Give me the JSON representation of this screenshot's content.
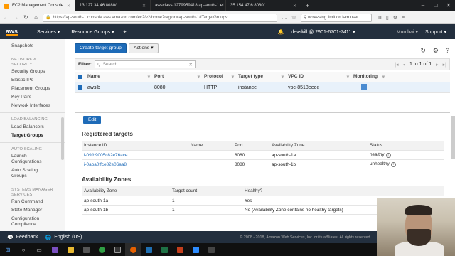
{
  "browser": {
    "tabs": [
      {
        "label": "EC2 Management Console",
        "active": true
      },
      {
        "label": "13.127.34.46:8080/",
        "active": false
      },
      {
        "label": "awsclass-1279959418.ap-south-1.el",
        "active": false
      },
      {
        "label": "35.154.47.6:8080/",
        "active": false
      }
    ],
    "url": "https://ap-south-1.console.aws.amazon.com/ec2/v2/home?region=ap-south-1#TargetGroups:",
    "search_value": "ncreasing limit on iam user"
  },
  "aws_nav": {
    "logo": "aws",
    "services": "Services",
    "resource_groups": "Resource Groups",
    "account": "devskill @ 2901-6701-7411",
    "region": "Mumbai",
    "support": "Support"
  },
  "sidebar": {
    "items": [
      {
        "type": "item",
        "label": "Snapshots"
      },
      {
        "type": "head",
        "label": "NETWORK & SECURITY"
      },
      {
        "type": "item",
        "label": "Security Groups"
      },
      {
        "type": "item",
        "label": "Elastic IPs"
      },
      {
        "type": "item",
        "label": "Placement Groups"
      },
      {
        "type": "item",
        "label": "Key Pairs"
      },
      {
        "type": "item",
        "label": "Network Interfaces"
      },
      {
        "type": "head",
        "label": "LOAD BALANCING"
      },
      {
        "type": "item",
        "label": "Load Balancers"
      },
      {
        "type": "item",
        "label": "Target Groups",
        "active": true
      },
      {
        "type": "head",
        "label": "AUTO SCALING"
      },
      {
        "type": "item",
        "label": "Launch Configurations"
      },
      {
        "type": "item",
        "label": "Auto Scaling Groups"
      },
      {
        "type": "head",
        "label": "SYSTEMS MANAGER SERVICES"
      },
      {
        "type": "item",
        "label": "Run Command"
      },
      {
        "type": "item",
        "label": "State Manager"
      },
      {
        "type": "item",
        "label": "Configuration Compliance"
      }
    ]
  },
  "main": {
    "create_button": "Create target group",
    "actions_button": "Actions",
    "filter_label": "Filter:",
    "search_placeholder": "Search",
    "pager_text": "1 to 1 of 1",
    "columns": [
      "Name",
      "Port",
      "Protocol",
      "Target type",
      "VPC ID",
      "Monitoring"
    ],
    "rows": [
      {
        "name": "awslb",
        "port": "8080",
        "protocol": "HTTP",
        "target_type": "instance",
        "vpc_id": "vpc-8518eeec"
      }
    ]
  },
  "detail": {
    "edit_button": "Edit",
    "registered_title": "Registered targets",
    "registered_columns": [
      "Instance ID",
      "Name",
      "Port",
      "Availability Zone",
      "Status"
    ],
    "registered_rows": [
      {
        "instance_id": "i-09fb9005c82e76ace",
        "name": "",
        "port": "8080",
        "az": "ap-south-1a",
        "status": "healthy"
      },
      {
        "instance_id": "i-0aba0ffce82e06aa8",
        "name": "",
        "port": "8080",
        "az": "ap-south-1b",
        "status": "unhealthy"
      }
    ],
    "az_title": "Availability Zones",
    "az_columns": [
      "Availability Zone",
      "Target count",
      "Healthy?"
    ],
    "az_rows": [
      {
        "zone": "ap-south-1a",
        "count": "1",
        "healthy": "Yes"
      },
      {
        "zone": "ap-south-1b",
        "count": "1",
        "healthy": "No (Availability Zone contains no healthy targets)"
      }
    ]
  },
  "footer": {
    "feedback": "Feedback",
    "language": "English (US)",
    "copyright": "© 2008 - 2018, Amazon Web Services, Inc. or its affiliates. All rights reserved."
  },
  "colors": {
    "aws_dark": "#232f3e",
    "primary": "#1e6bb8",
    "orange": "#ff9900"
  }
}
